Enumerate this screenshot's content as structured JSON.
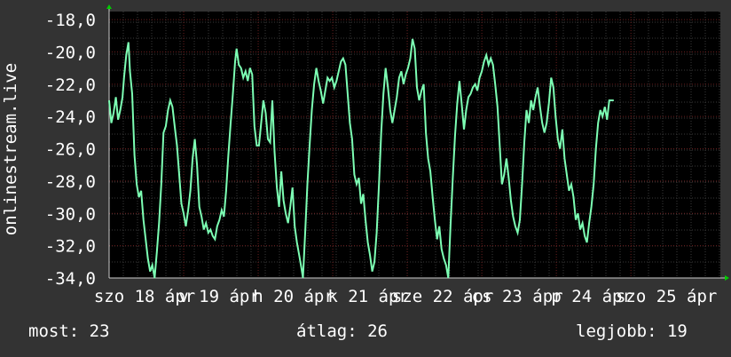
{
  "chart_data": {
    "type": "line",
    "ylabel": "onlinestream.live",
    "ylim": [
      -34,
      -17.5
    ],
    "yticks": [
      -18,
      -20,
      -22,
      -24,
      -26,
      -28,
      -30,
      -32,
      -34
    ],
    "ytick_labels": [
      "-18,0",
      "-20,0",
      "-22,0",
      "-24,0",
      "-26,0",
      "-28,0",
      "-30,0",
      "-32,0",
      "-34,0"
    ],
    "xlim": [
      0,
      8.2
    ],
    "xticks": [
      {
        "x": 0.5,
        "label": "szo 18 ápr"
      },
      {
        "x": 1.5,
        "label": "v 19 ápr"
      },
      {
        "x": 2.5,
        "label": "h 20 ápr"
      },
      {
        "x": 3.5,
        "label": "k 21 ápr"
      },
      {
        "x": 4.5,
        "label": "sze 22 ápr"
      },
      {
        "x": 5.5,
        "label": "cs 23 ápr"
      },
      {
        "x": 6.5,
        "label": "p 24 ápr"
      },
      {
        "x": 7.5,
        "label": "szo 25 ápr"
      }
    ],
    "grid": true,
    "colors": {
      "background": "#333333",
      "plot_area": "#000000",
      "grid_minor": "#3a3a3a",
      "grid_major": "#6a1f1f",
      "line": "#7dffb4",
      "axis": "#cccccc",
      "arrow": "#00cc00"
    },
    "series": [
      {
        "values": [
          [
            0.0,
            -23.0
          ],
          [
            0.03,
            -24.4
          ],
          [
            0.06,
            -23.8
          ],
          [
            0.09,
            -22.8
          ],
          [
            0.12,
            -24.2
          ],
          [
            0.15,
            -23.6
          ],
          [
            0.18,
            -22.8
          ],
          [
            0.2,
            -21.6
          ],
          [
            0.23,
            -20.2
          ],
          [
            0.26,
            -19.4
          ],
          [
            0.28,
            -21.2
          ],
          [
            0.31,
            -22.6
          ],
          [
            0.34,
            -26.4
          ],
          [
            0.37,
            -28.2
          ],
          [
            0.4,
            -29.0
          ],
          [
            0.43,
            -28.6
          ],
          [
            0.46,
            -30.4
          ],
          [
            0.49,
            -31.6
          ],
          [
            0.52,
            -32.8
          ],
          [
            0.55,
            -33.6
          ],
          [
            0.58,
            -33.2
          ],
          [
            0.61,
            -34.0
          ],
          [
            0.64,
            -32.4
          ],
          [
            0.67,
            -30.6
          ],
          [
            0.7,
            -28.2
          ],
          [
            0.73,
            -25.0
          ],
          [
            0.76,
            -24.6
          ],
          [
            0.79,
            -23.6
          ],
          [
            0.82,
            -23.0
          ],
          [
            0.85,
            -23.4
          ],
          [
            0.88,
            -24.6
          ],
          [
            0.91,
            -25.8
          ],
          [
            0.94,
            -27.6
          ],
          [
            0.97,
            -29.4
          ],
          [
            1.0,
            -30.0
          ],
          [
            1.03,
            -30.8
          ],
          [
            1.06,
            -29.8
          ],
          [
            1.09,
            -28.6
          ],
          [
            1.12,
            -26.6
          ],
          [
            1.15,
            -25.4
          ],
          [
            1.18,
            -27.0
          ],
          [
            1.21,
            -29.6
          ],
          [
            1.24,
            -30.2
          ],
          [
            1.27,
            -31.0
          ],
          [
            1.3,
            -30.6
          ],
          [
            1.33,
            -31.2
          ],
          [
            1.36,
            -31.0
          ],
          [
            1.39,
            -31.4
          ],
          [
            1.42,
            -31.6
          ],
          [
            1.45,
            -30.8
          ],
          [
            1.48,
            -30.4
          ],
          [
            1.51,
            -29.8
          ],
          [
            1.54,
            -30.2
          ],
          [
            1.57,
            -28.6
          ],
          [
            1.6,
            -26.4
          ],
          [
            1.63,
            -24.4
          ],
          [
            1.66,
            -22.6
          ],
          [
            1.69,
            -20.6
          ],
          [
            1.71,
            -19.8
          ],
          [
            1.74,
            -20.8
          ],
          [
            1.77,
            -21.0
          ],
          [
            1.8,
            -21.6
          ],
          [
            1.83,
            -21.2
          ],
          [
            1.86,
            -21.8
          ],
          [
            1.89,
            -21.0
          ],
          [
            1.92,
            -21.4
          ],
          [
            1.95,
            -24.6
          ],
          [
            1.98,
            -25.8
          ],
          [
            2.01,
            -25.8
          ],
          [
            2.04,
            -24.4
          ],
          [
            2.07,
            -23.0
          ],
          [
            2.1,
            -23.8
          ],
          [
            2.13,
            -25.4
          ],
          [
            2.16,
            -25.6
          ],
          [
            2.19,
            -23.0
          ],
          [
            2.22,
            -26.2
          ],
          [
            2.25,
            -28.4
          ],
          [
            2.28,
            -29.6
          ],
          [
            2.31,
            -27.4
          ],
          [
            2.34,
            -29.2
          ],
          [
            2.37,
            -30.0
          ],
          [
            2.4,
            -30.6
          ],
          [
            2.43,
            -29.6
          ],
          [
            2.46,
            -28.4
          ],
          [
            2.49,
            -30.8
          ],
          [
            2.52,
            -31.8
          ],
          [
            2.55,
            -32.6
          ],
          [
            2.58,
            -33.4
          ],
          [
            2.6,
            -34.0
          ],
          [
            2.63,
            -31.2
          ],
          [
            2.66,
            -28.2
          ],
          [
            2.69,
            -25.8
          ],
          [
            2.72,
            -23.6
          ],
          [
            2.75,
            -22.0
          ],
          [
            2.78,
            -21.0
          ],
          [
            2.81,
            -21.8
          ],
          [
            2.84,
            -22.4
          ],
          [
            2.87,
            -23.2
          ],
          [
            2.9,
            -22.4
          ],
          [
            2.93,
            -21.6
          ],
          [
            2.96,
            -21.8
          ],
          [
            2.99,
            -21.6
          ],
          [
            3.02,
            -22.2
          ],
          [
            3.05,
            -21.8
          ],
          [
            3.08,
            -21.2
          ],
          [
            3.11,
            -20.6
          ],
          [
            3.14,
            -20.4
          ],
          [
            3.17,
            -20.8
          ],
          [
            3.2,
            -22.6
          ],
          [
            3.23,
            -24.4
          ],
          [
            3.26,
            -25.4
          ],
          [
            3.29,
            -27.6
          ],
          [
            3.32,
            -28.2
          ],
          [
            3.35,
            -27.8
          ],
          [
            3.38,
            -29.4
          ],
          [
            3.41,
            -28.8
          ],
          [
            3.44,
            -30.4
          ],
          [
            3.47,
            -31.8
          ],
          [
            3.5,
            -32.6
          ],
          [
            3.53,
            -33.6
          ],
          [
            3.56,
            -33.0
          ],
          [
            3.59,
            -31.2
          ],
          [
            3.62,
            -28.2
          ],
          [
            3.65,
            -25.0
          ],
          [
            3.68,
            -22.6
          ],
          [
            3.71,
            -21.0
          ],
          [
            3.74,
            -22.2
          ],
          [
            3.77,
            -23.6
          ],
          [
            3.8,
            -24.4
          ],
          [
            3.83,
            -23.6
          ],
          [
            3.86,
            -22.8
          ],
          [
            3.89,
            -21.6
          ],
          [
            3.92,
            -21.2
          ],
          [
            3.95,
            -22.0
          ],
          [
            3.98,
            -21.4
          ],
          [
            4.01,
            -21.0
          ],
          [
            4.04,
            -20.4
          ],
          [
            4.07,
            -19.2
          ],
          [
            4.1,
            -19.8
          ],
          [
            4.13,
            -22.2
          ],
          [
            4.16,
            -23.0
          ],
          [
            4.19,
            -22.4
          ],
          [
            4.22,
            -22.0
          ],
          [
            4.25,
            -25.0
          ],
          [
            4.28,
            -26.6
          ],
          [
            4.31,
            -27.4
          ],
          [
            4.34,
            -29.0
          ],
          [
            4.37,
            -30.4
          ],
          [
            4.4,
            -31.6
          ],
          [
            4.43,
            -30.8
          ],
          [
            4.46,
            -32.2
          ],
          [
            4.49,
            -32.8
          ],
          [
            4.52,
            -33.2
          ],
          [
            4.55,
            -34.0
          ],
          [
            4.58,
            -30.8
          ],
          [
            4.61,
            -27.8
          ],
          [
            4.64,
            -25.2
          ],
          [
            4.67,
            -23.2
          ],
          [
            4.7,
            -21.8
          ],
          [
            4.73,
            -23.2
          ],
          [
            4.76,
            -24.8
          ],
          [
            4.79,
            -23.6
          ],
          [
            4.82,
            -22.8
          ],
          [
            4.85,
            -22.6
          ],
          [
            4.88,
            -22.2
          ],
          [
            4.91,
            -22.0
          ],
          [
            4.94,
            -22.4
          ],
          [
            4.97,
            -21.6
          ],
          [
            5.0,
            -21.2
          ],
          [
            5.03,
            -20.6
          ],
          [
            5.06,
            -20.2
          ],
          [
            5.09,
            -20.8
          ],
          [
            5.12,
            -20.4
          ],
          [
            5.15,
            -20.8
          ],
          [
            5.18,
            -22.0
          ],
          [
            5.21,
            -23.4
          ],
          [
            5.24,
            -25.8
          ],
          [
            5.27,
            -28.2
          ],
          [
            5.3,
            -27.6
          ],
          [
            5.33,
            -26.6
          ],
          [
            5.36,
            -27.8
          ],
          [
            5.39,
            -29.2
          ],
          [
            5.42,
            -30.2
          ],
          [
            5.45,
            -30.8
          ],
          [
            5.48,
            -31.2
          ],
          [
            5.51,
            -30.4
          ],
          [
            5.54,
            -28.2
          ],
          [
            5.57,
            -25.6
          ],
          [
            5.6,
            -23.6
          ],
          [
            5.63,
            -24.4
          ],
          [
            5.66,
            -23.0
          ],
          [
            5.69,
            -23.6
          ],
          [
            5.72,
            -22.8
          ],
          [
            5.75,
            -22.2
          ],
          [
            5.78,
            -23.4
          ],
          [
            5.81,
            -24.4
          ],
          [
            5.84,
            -25.0
          ],
          [
            5.87,
            -24.4
          ],
          [
            5.9,
            -23.2
          ],
          [
            5.93,
            -21.6
          ],
          [
            5.96,
            -22.2
          ],
          [
            5.99,
            -24.0
          ],
          [
            6.02,
            -25.4
          ],
          [
            6.05,
            -26.0
          ],
          [
            6.08,
            -24.8
          ],
          [
            6.11,
            -26.6
          ],
          [
            6.14,
            -27.6
          ],
          [
            6.17,
            -28.6
          ],
          [
            6.2,
            -28.2
          ],
          [
            6.23,
            -29.0
          ],
          [
            6.26,
            -30.4
          ],
          [
            6.29,
            -30.0
          ],
          [
            6.32,
            -31.0
          ],
          [
            6.35,
            -30.6
          ],
          [
            6.38,
            -31.4
          ],
          [
            6.41,
            -31.8
          ],
          [
            6.44,
            -30.6
          ],
          [
            6.47,
            -29.6
          ],
          [
            6.5,
            -28.2
          ],
          [
            6.53,
            -26.0
          ],
          [
            6.56,
            -24.4
          ],
          [
            6.59,
            -23.6
          ],
          [
            6.62,
            -24.0
          ],
          [
            6.65,
            -23.4
          ],
          [
            6.68,
            -24.2
          ],
          [
            6.71,
            -23.0
          ],
          [
            6.74,
            -23.0
          ],
          [
            6.77,
            -23.0
          ]
        ]
      }
    ]
  },
  "footer": {
    "now": "most: 23",
    "avg": "átlag: 26",
    "best": "legjobb: 19"
  }
}
